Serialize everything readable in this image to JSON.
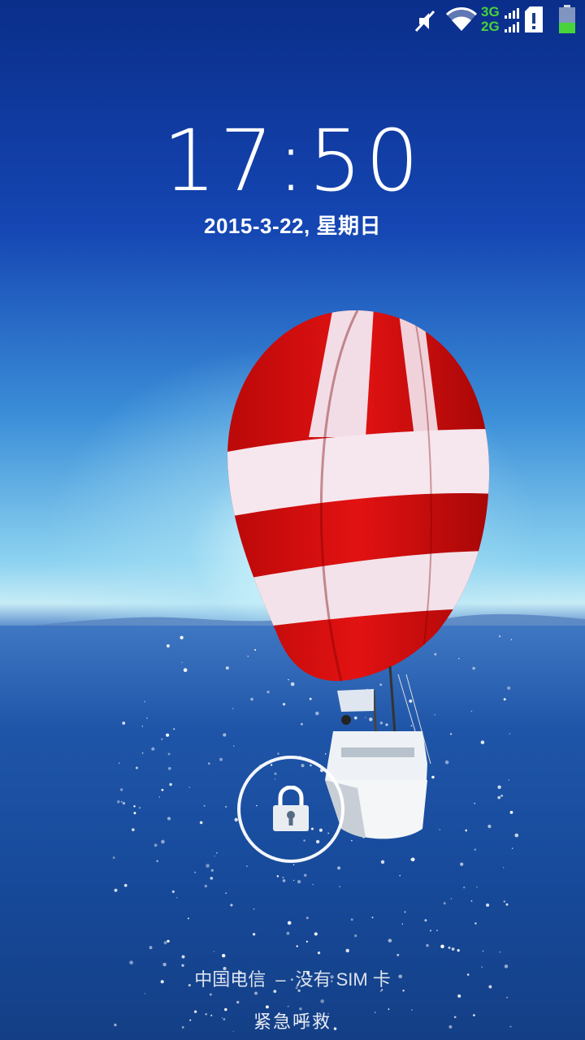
{
  "status_bar": {
    "icons": [
      "mute-icon",
      "wifi-icon",
      "signal-icon",
      "sim-alert-icon",
      "battery-icon"
    ],
    "network_top": "3G",
    "network_bottom": "2G",
    "accent_green": "#49d33a"
  },
  "lockscreen": {
    "time": "17:50",
    "date": "2015-3-22",
    "weekday": "星期日",
    "carrier": "中国电信",
    "sim_status": "没有 SIM 卡",
    "emergency_call": "紧急呼救",
    "unlock_icon": "lock-icon"
  }
}
